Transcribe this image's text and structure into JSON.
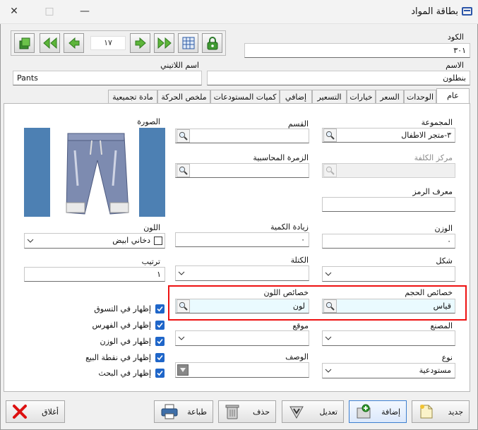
{
  "window": {
    "title": "بطاقة المواد",
    "close_glyph": "✕",
    "max_glyph": "□",
    "min_glyph": "—"
  },
  "nav": {
    "record_number": "١٧"
  },
  "header": {
    "code_label": "الكود",
    "code_value": "٣٠١",
    "name_label": "الاسم",
    "name_value": "بنطلون",
    "latin_label": "اسم اللاتيني",
    "latin_value": "Pants"
  },
  "tabs": [
    "عام",
    "الوحدات",
    "السعر",
    "خيارات",
    "التسعير",
    "إضافي",
    "كميات المستودعات",
    "ملخص الحركة",
    "مادة تجميعية"
  ],
  "general": {
    "group_label": "المجموعة",
    "group_value": "٣-متجر الاطفال",
    "section_label": "القسم",
    "section_value": "",
    "image_label": "الصورة",
    "cost_center_label": "مركز الكلفة",
    "cost_center_value": "",
    "accounting_group_label": "الزمرة المحاسبية",
    "accounting_group_value": "",
    "symbol_label": "معرف الرمز",
    "symbol_value": "",
    "weight_label": "الوزن",
    "weight_value": "٠",
    "qty_increase_label": "زيادة الكمية",
    "qty_increase_value": "٠",
    "color_label": "اللون",
    "color_value": "دخاني ابيض",
    "shape_label": "شكل",
    "shape_value": "",
    "block_label": "الكتلة",
    "block_value": "",
    "order_label": "ترتيب",
    "order_value": "١",
    "size_props_label": "خصائص الحجم",
    "size_props_value": "قياس",
    "color_props_label": "خصائص اللون",
    "color_props_value": "لون",
    "factory_label": "المصنع",
    "factory_value": "",
    "location_label": "موقع",
    "location_value": "",
    "type_label": "نوع",
    "type_value": "مستودعية",
    "desc_label": "الوصف",
    "desc_value": "",
    "checks": [
      {
        "label": "إظهار في التسوق",
        "checked": true
      },
      {
        "label": "إظهار في الفهرس",
        "checked": true
      },
      {
        "label": "إظهار في الوزن",
        "checked": true
      },
      {
        "label": "إظهار في نقطة البيع",
        "checked": true
      },
      {
        "label": "إظهار في البحث",
        "checked": true
      }
    ]
  },
  "buttons": {
    "new": "جديد",
    "add": "إضافة",
    "edit": "تعديل",
    "delete": "حذف",
    "print": "طباعة",
    "close": "أغلاق"
  },
  "colors": {
    "accent": "#1f66c9",
    "highlight_border": "#e11111",
    "image_side": "#4d80b3"
  }
}
